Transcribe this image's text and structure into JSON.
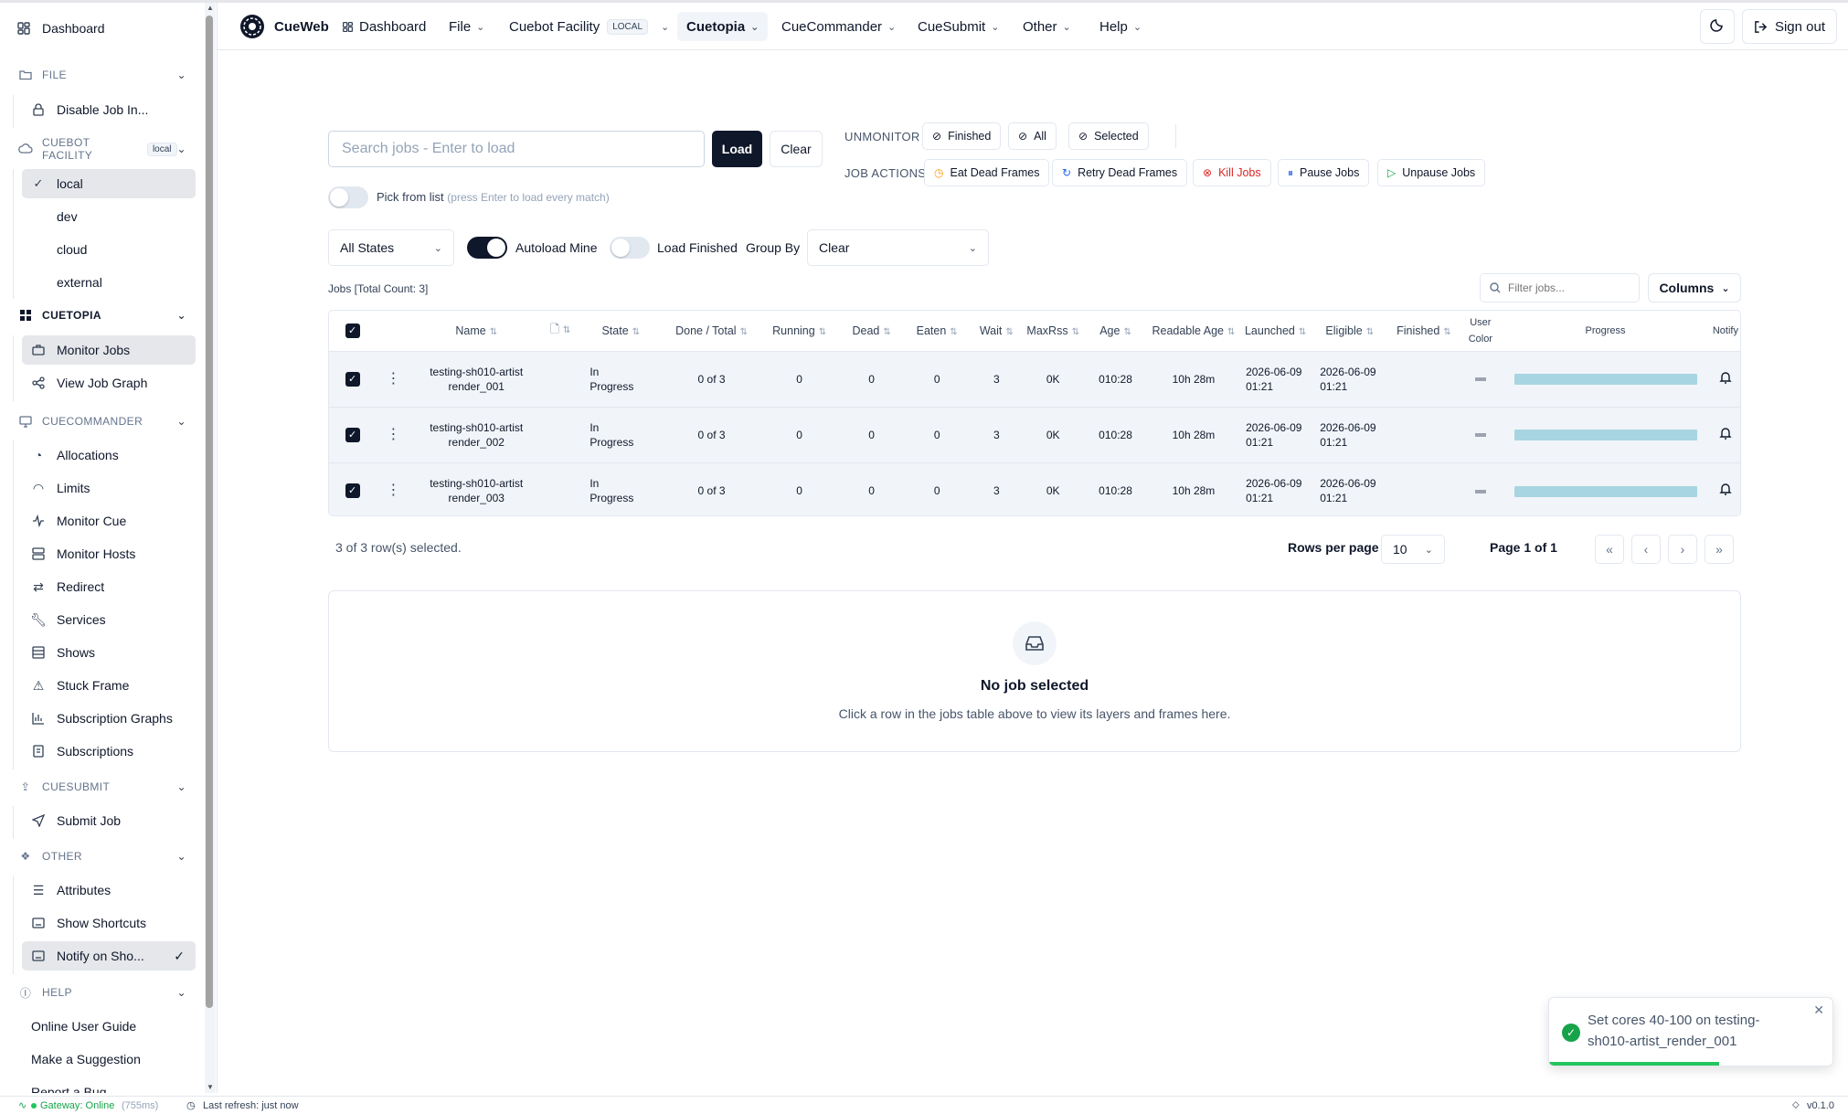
{
  "sidebar": {
    "dashboard": "Dashboard",
    "sections": {
      "file": {
        "label": "FILE",
        "items": [
          "Disable Job In..."
        ]
      },
      "facility": {
        "label": "CUEBOT FACILITY",
        "badge": "local",
        "items": [
          "local",
          "dev",
          "cloud",
          "external"
        ]
      },
      "cuetopia": {
        "label": "CUETOPIA",
        "items": [
          "Monitor Jobs",
          "View Job Graph"
        ]
      },
      "cuecommander": {
        "label": "CUECOMMANDER",
        "items": [
          "Allocations",
          "Limits",
          "Monitor Cue",
          "Monitor Hosts",
          "Redirect",
          "Services",
          "Shows",
          "Stuck Frame",
          "Subscription Graphs",
          "Subscriptions"
        ]
      },
      "cuesubmit": {
        "label": "CUESUBMIT",
        "items": [
          "Submit Job"
        ]
      },
      "other": {
        "label": "OTHER",
        "items": [
          "Attributes",
          "Show Shortcuts",
          "Notify on Sho..."
        ]
      },
      "help": {
        "label": "HELP",
        "items": [
          "Online User Guide",
          "Make a Suggestion",
          "Report a Bug"
        ]
      }
    }
  },
  "topnav": {
    "brand": "CueWeb",
    "items": [
      "Dashboard",
      "File",
      "Cuebot Facility",
      "Cuetopia",
      "CueCommander",
      "CueSubmit",
      "Other",
      "Help"
    ],
    "facility_badge": "LOCAL",
    "sign_out": "Sign out"
  },
  "search": {
    "placeholder": "Search jobs - Enter to load",
    "load": "Load",
    "clear": "Clear"
  },
  "pick_from_list": {
    "label": "Pick from list",
    "hint": "(press Enter to load every match)"
  },
  "unmonitor": {
    "label": "UNMONITOR",
    "buttons": [
      "Finished",
      "All",
      "Selected"
    ]
  },
  "job_actions": {
    "label": "JOB ACTIONS",
    "buttons": [
      "Eat Dead Frames",
      "Retry Dead Frames",
      "Kill Jobs",
      "Pause Jobs",
      "Unpause Jobs"
    ]
  },
  "filters": {
    "state": "All States",
    "autoload_mine": "Autoload Mine",
    "load_finished": "Load Finished",
    "group_by_label": "Group By",
    "group_by_value": "Clear"
  },
  "jobs_count": "Jobs [Total Count: 3]",
  "filter_placeholder": "Filter jobs...",
  "columns_button": "Columns",
  "table": {
    "headers": [
      "Name",
      "State",
      "Done / Total",
      "Running",
      "Dead",
      "Eaten",
      "Wait",
      "MaxRss",
      "Age",
      "Readable Age",
      "Launched",
      "Eligible",
      "Finished",
      "User Color",
      "Progress",
      "Notify"
    ],
    "rows": [
      {
        "name1": "testing-sh010-artist",
        "name2": "render_001",
        "state1": "In",
        "state2": "Progress",
        "done": "0 of 3",
        "running": "0",
        "dead": "0",
        "eaten": "0",
        "wait": "3",
        "maxrss": "0K",
        "age": "010:28",
        "readable": "10h 28m",
        "launched1": "2026-06-09",
        "launched2": "01:21",
        "eligible1": "2026-06-09",
        "eligible2": "01:21",
        "finished": "",
        "progress": 1.0
      },
      {
        "name1": "testing-sh010-artist",
        "name2": "render_002",
        "state1": "In",
        "state2": "Progress",
        "done": "0 of 3",
        "running": "0",
        "dead": "0",
        "eaten": "0",
        "wait": "3",
        "maxrss": "0K",
        "age": "010:28",
        "readable": "10h 28m",
        "launched1": "2026-06-09",
        "launched2": "01:21",
        "eligible1": "2026-06-09",
        "eligible2": "01:21",
        "finished": "",
        "progress": 1.0
      },
      {
        "name1": "testing-sh010-artist",
        "name2": "render_003",
        "state1": "In",
        "state2": "Progress",
        "done": "0 of 3",
        "running": "0",
        "dead": "0",
        "eaten": "0",
        "wait": "3",
        "maxrss": "0K",
        "age": "010:28",
        "readable": "10h 28m",
        "launched1": "2026-06-09",
        "launched2": "01:21",
        "eligible1": "2026-06-09",
        "eligible2": "01:21",
        "finished": "",
        "progress": 1.0
      }
    ]
  },
  "footer": {
    "selected": "3 of 3 row(s) selected.",
    "rows_per_page_label": "Rows per page",
    "rows_per_page": "10",
    "page": "Page 1 of 1"
  },
  "empty": {
    "title": "No job selected",
    "desc": "Click a row in the jobs table above to view its layers and frames here."
  },
  "toast": {
    "message_line1": "Set cores 40-100 on testing-",
    "message_line2": "sh010-artist_render_001",
    "progress": 0.6
  },
  "status": {
    "gateway": "Gateway: Online",
    "latency": "(755ms)",
    "refresh": "Last refresh: just now",
    "version": "v0.1.0"
  },
  "colors": {
    "accent": "#0f172a",
    "progress": "#a8d5e2",
    "success": "#22c55e",
    "danger": "#dc2626"
  }
}
